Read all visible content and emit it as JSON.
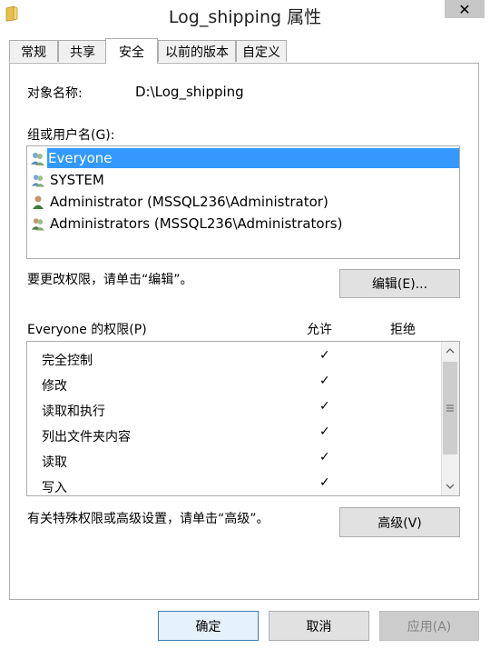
{
  "window": {
    "title": "Log_shipping 属性",
    "close_symbol": "✕",
    "app_icon": "folder-icon"
  },
  "tabs": [
    {
      "label": "常规"
    },
    {
      "label": "共享"
    },
    {
      "label": "安全",
      "active": true
    },
    {
      "label": "以前的版本"
    },
    {
      "label": "自定义"
    }
  ],
  "security": {
    "object_name_label": "对象名称:",
    "object_name_value": "D:\\Log_shipping",
    "groups_label": "组或用户名(G):",
    "users": [
      {
        "name": "Everyone",
        "icon": "users-group-icon",
        "selected": true
      },
      {
        "name": "SYSTEM",
        "icon": "users-group-icon"
      },
      {
        "name": "Administrator (MSSQL236\\Administrator)",
        "icon": "user-icon"
      },
      {
        "name": "Administrators (MSSQL236\\Administrators)",
        "icon": "users-group-icon"
      }
    ],
    "edit_hint": "要更改权限，请单击“编辑”。",
    "edit_button": "编辑(E)...",
    "permissions_label": "Everyone 的权限(P)",
    "allow_header": "允许",
    "deny_header": "拒绝",
    "permissions": [
      {
        "name": "完全控制",
        "allow": "✓",
        "deny": ""
      },
      {
        "name": "修改",
        "allow": "✓",
        "deny": ""
      },
      {
        "name": "读取和执行",
        "allow": "✓",
        "deny": ""
      },
      {
        "name": "列出文件夹内容",
        "allow": "✓",
        "deny": ""
      },
      {
        "name": "读取",
        "allow": "✓",
        "deny": ""
      },
      {
        "name": "写入",
        "allow": "✓",
        "deny": ""
      }
    ],
    "advanced_hint": "有关特殊权限或高级设置，请单击“高级”。",
    "advanced_button": "高级(V)"
  },
  "footer": {
    "ok_button": "确定",
    "cancel_button": "取消",
    "apply_button": "应用(A)"
  },
  "colors": {
    "selection": "#3399ff",
    "focus_border": "#3c7fb1"
  }
}
